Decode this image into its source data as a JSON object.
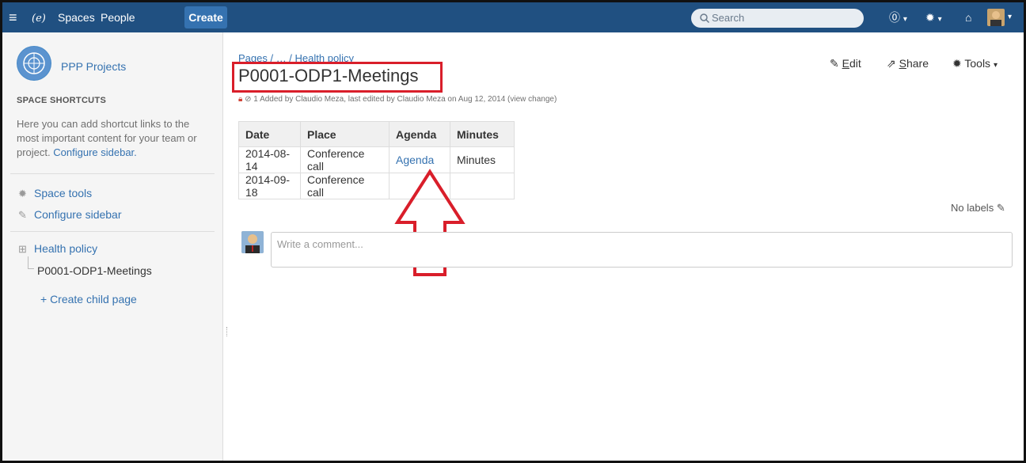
{
  "topbar": {
    "nav": [
      "Spaces",
      "People"
    ],
    "create_label": "Create",
    "search_placeholder": "Search",
    "brand_color": "#205081"
  },
  "sidebar": {
    "space_name": "PPP Projects",
    "shortcuts_title": "SPACE SHORTCUTS",
    "shortcuts_text": "Here you can add shortcut links to the most important content for your team or project.",
    "configure_link": "Configure sidebar.",
    "space_tools": "Space tools",
    "configure_sidebar": "Configure sidebar",
    "tree_parent": "Health policy",
    "tree_child": "P0001-ODP1-Meetings",
    "create_child": "+ Create child page"
  },
  "page": {
    "breadcrumb": "Pages / … / Health policy",
    "title": "P0001-ODP1-Meetings",
    "byline": "1 Added by Claudio Meza, last edited by Claudio Meza on Aug 12, 2014  (view change)",
    "actions": {
      "edit_e": "E",
      "edit_rest": "dit",
      "share_s": "S",
      "share_rest": "hare",
      "tools": "Tools"
    },
    "table": {
      "headers": [
        "Date",
        "Place",
        "Agenda",
        "Minutes"
      ],
      "rows": [
        [
          "2014-08-14",
          "Conference call",
          "Agenda",
          "Minutes"
        ],
        [
          "2014-09-18",
          "Conference call",
          "",
          ""
        ]
      ]
    },
    "no_labels": "No labels",
    "comment_placeholder": "Write a comment..."
  },
  "annotation_color": "#d91e2a"
}
